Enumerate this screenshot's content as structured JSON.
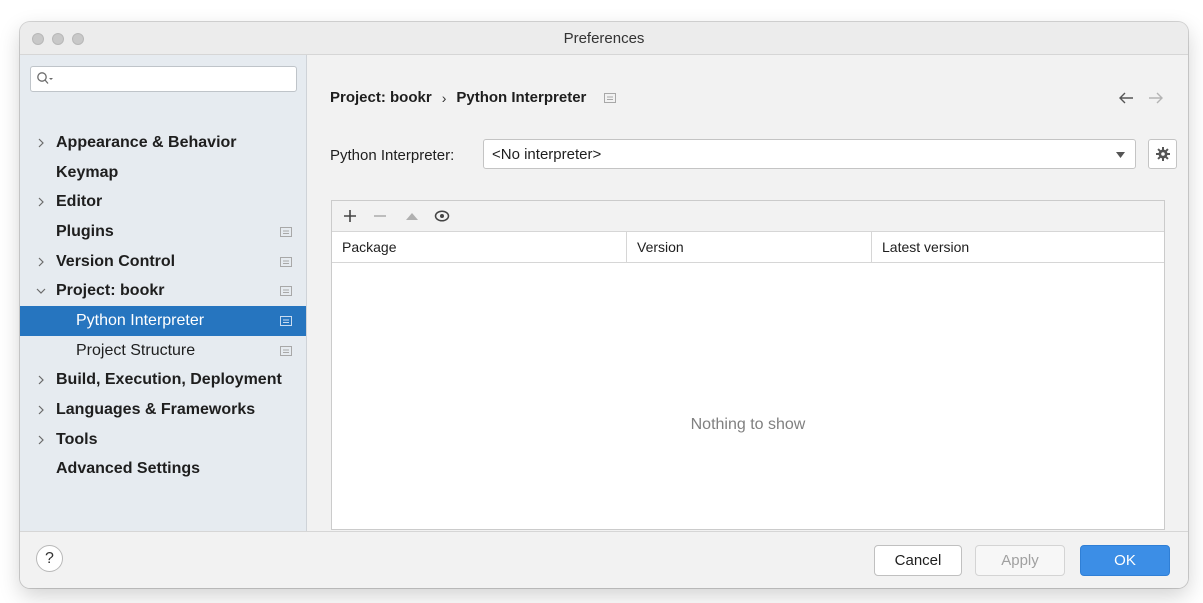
{
  "window": {
    "title": "Preferences"
  },
  "sidebar": {
    "search": {
      "value": "",
      "placeholder": ""
    },
    "items": [
      {
        "label": "Appearance & Behavior",
        "expandable": true,
        "expanded": false
      },
      {
        "label": "Keymap",
        "expandable": false
      },
      {
        "label": "Editor",
        "expandable": true,
        "expanded": false
      },
      {
        "label": "Plugins",
        "expandable": false
      },
      {
        "label": "Version Control",
        "expandable": true,
        "expanded": false
      },
      {
        "label": "Project: bookr",
        "expandable": true,
        "expanded": true
      },
      {
        "label": "Python Interpreter",
        "child": true,
        "selected": true
      },
      {
        "label": "Project Structure",
        "child": true
      },
      {
        "label": "Build, Execution, Deployment",
        "expandable": true,
        "expanded": false
      },
      {
        "label": "Languages & Frameworks",
        "expandable": true,
        "expanded": false
      },
      {
        "label": "Tools",
        "expandable": true,
        "expanded": false
      },
      {
        "label": "Advanced Settings",
        "expandable": false
      }
    ]
  },
  "breadcrumb": {
    "parent": "Project: bookr",
    "separator": "›",
    "current": "Python Interpreter"
  },
  "interpreter": {
    "label": "Python Interpreter:",
    "value": "<No interpreter>"
  },
  "packages": {
    "columns": [
      "Package",
      "Version",
      "Latest version"
    ],
    "rows": [],
    "empty_text": "Nothing to show"
  },
  "footer": {
    "help_label": "?",
    "cancel_label": "Cancel",
    "apply_label": "Apply",
    "ok_label": "OK"
  },
  "colors": {
    "selection": "#2675bf",
    "ok_button": "#3c8ee6",
    "sidebar_bg": "#e6ebf0"
  }
}
